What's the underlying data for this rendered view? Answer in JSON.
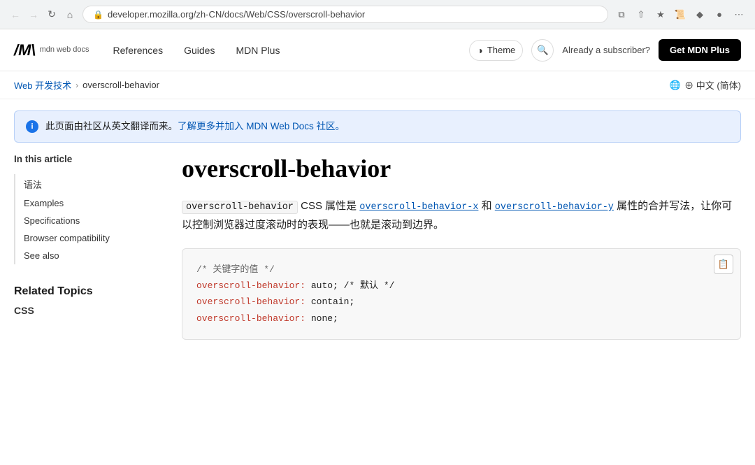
{
  "browser": {
    "url": "developer.mozilla.org/zh-CN/docs/Web/CSS/overscroll-behavior",
    "back_btn": "←",
    "forward_btn": "→",
    "refresh_btn": "↺",
    "home_btn": "⌂",
    "tab_icon": "🌐"
  },
  "header": {
    "logo_m": "/",
    "logo_name": "mdn web docs",
    "nav_items": [
      "References",
      "Guides",
      "MDN Plus"
    ],
    "theme_label": "Theme",
    "search_placeholder": "Search",
    "subscriber_text": "Already a subscriber?",
    "get_plus_label": "Get MDN Plus"
  },
  "breadcrumb": {
    "parent": "Web 开发技术",
    "separator": "›",
    "current": "overscroll-behavior",
    "lang": "⊕ 中文 (简体)"
  },
  "banner": {
    "text": "此页面由社区从英文翻译而来。了解更多并加入 MDN Web Docs 社区。",
    "link_text": "了解更多并加入 MDN Web Docs 社区。"
  },
  "sidebar": {
    "toc_title": "In this article",
    "toc_items": [
      "语法",
      "Examples",
      "Specifications",
      "Browser compatibility",
      "See also"
    ],
    "related_title": "Related Topics",
    "related_sub": "CSS"
  },
  "content": {
    "page_title": "overscroll-behavior",
    "description_parts": {
      "code1": "overscroll-behavior",
      "text1": " CSS 属性是 ",
      "link1": "overscroll-behavior-x",
      "text2": " 和 ",
      "link2": "overscroll-behavior-y",
      "text3": " 属性的合并写法，让你可以控制浏览器过度滚动时的表现——也就是滚动到边界。"
    },
    "code_block": {
      "comment1": "/* 关键字的值 */",
      "line1_prop": "overscroll-behavior:",
      "line1_val": " auto; /* 默认 */",
      "line2_prop": "overscroll-behavior:",
      "line2_val": " contain;",
      "line3_prop": "overscroll-behavior:",
      "line3_val": " none;"
    }
  }
}
